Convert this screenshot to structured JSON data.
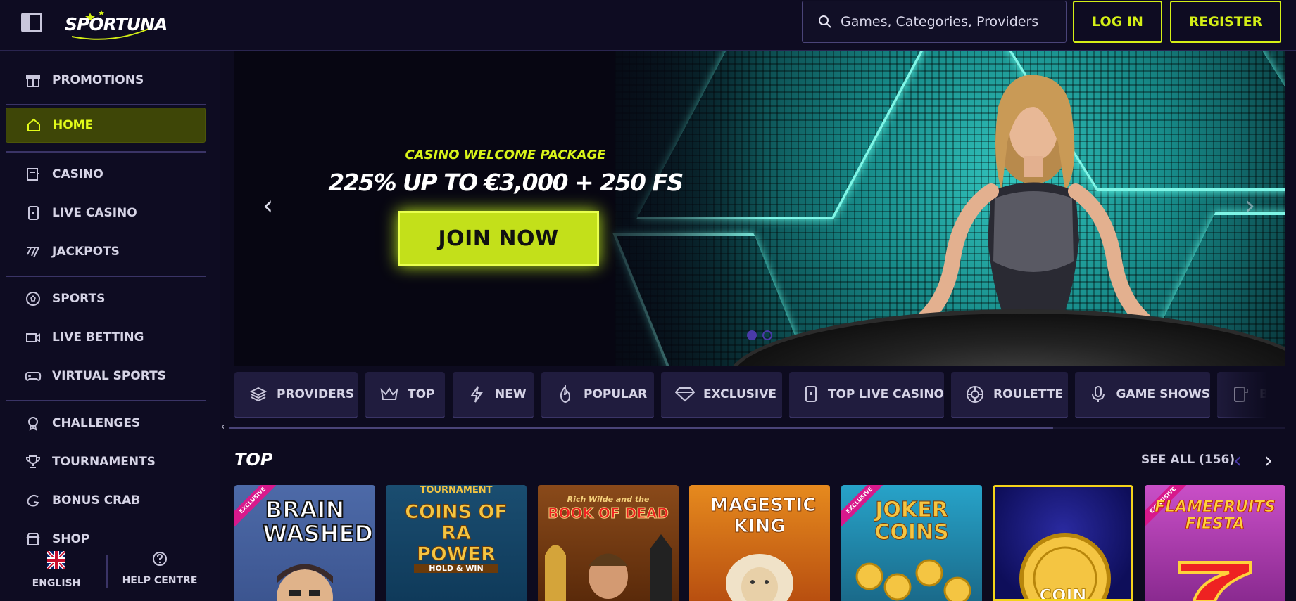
{
  "header": {
    "logo_text": "SPORTUNA",
    "search_placeholder": "Games, Categories, Providers",
    "login_label": "LOG IN",
    "register_label": "REGISTER"
  },
  "sidebar": {
    "items": [
      {
        "label": "PROMOTIONS",
        "icon": "gift-icon"
      },
      {
        "label": "HOME",
        "icon": "home-icon",
        "active": true
      },
      {
        "label": "CASINO",
        "icon": "casino-icon"
      },
      {
        "label": "LIVE CASINO",
        "icon": "live-casino-icon"
      },
      {
        "label": "JACKPOTS",
        "icon": "jackpot-icon"
      },
      {
        "label": "SPORTS",
        "icon": "soccer-ball-icon"
      },
      {
        "label": "LIVE BETTING",
        "icon": "video-camera-icon"
      },
      {
        "label": "VIRTUAL SPORTS",
        "icon": "gamepad-icon"
      },
      {
        "label": "CHALLENGES",
        "icon": "medal-icon"
      },
      {
        "label": "TOURNAMENTS",
        "icon": "trophy-icon"
      },
      {
        "label": "BONUS CRAB",
        "icon": "crab-icon"
      },
      {
        "label": "SHOP",
        "icon": "shop-icon"
      }
    ],
    "language_label": "ENGLISH",
    "help_label": "HELP CENTRE"
  },
  "hero": {
    "subtitle": "CASINO WELCOME PACKAGE",
    "title": "225% UP TO €3,000 + 250 FS",
    "cta_label": "JOIN NOW",
    "prev_arrow": "‹",
    "next_arrow": "›",
    "slides": 2,
    "active_slide": 1
  },
  "categories": [
    {
      "label": "PROVIDERS",
      "icon": "layers-icon"
    },
    {
      "label": "TOP",
      "icon": "crown-icon"
    },
    {
      "label": "NEW",
      "icon": "lightning-icon"
    },
    {
      "label": "POPULAR",
      "icon": "flame-icon"
    },
    {
      "label": "EXCLUSIVE",
      "icon": "diamond-icon"
    },
    {
      "label": "TOP LIVE CASINO",
      "icon": "card-icon"
    },
    {
      "label": "ROULETTE",
      "icon": "roulette-icon"
    },
    {
      "label": "GAME SHOWS",
      "icon": "microphone-icon"
    },
    {
      "label": "B",
      "icon": "slot-machine-icon"
    }
  ],
  "top_section": {
    "title": "TOP",
    "see_all_label": "SEE ALL (156)",
    "games": [
      {
        "title": "BRAIN WASHED",
        "badge": "EXCLUSIVE"
      },
      {
        "title": "COINS OF RA POWER",
        "badge": "TOURNAMENT",
        "subtitle": "HOLD & WIN"
      },
      {
        "title": "BOOK OF DEAD",
        "tagline": "Rich Wilde and the"
      },
      {
        "title": "MAGESTIC KING"
      },
      {
        "title": "JOKER COINS",
        "badge": "EXCLUSIVE"
      },
      {
        "title": "COIN"
      },
      {
        "title": "FLAMEFRUITS FIESTA",
        "badge": "EXCLUSIVE"
      }
    ]
  },
  "colors": {
    "accent": "#d4ef16",
    "bg": "#0d0b1f",
    "panel": "#201c3e",
    "active_bg": "#3e4607"
  }
}
